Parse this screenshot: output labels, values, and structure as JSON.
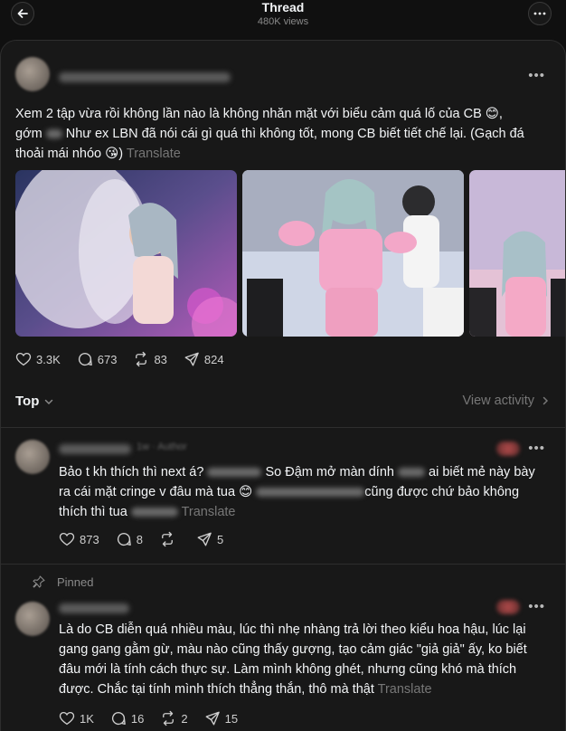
{
  "header": {
    "title": "Thread",
    "views": "480K views"
  },
  "post": {
    "text_line1": "Xem 2 tập vừa rồi không lần nào là không nhăn mặt với biểu cảm quá lố của CB ",
    "emoji1": "😊",
    "text_line1_end": ",",
    "text_line2_a": "gớm",
    "text_line2_b": " Như ex LBN đã nói cái gì quá thì không tốt, mong CB biết tiết chế lại. (Gạch đá",
    "text_line3": "thoải mái nhóo ",
    "emoji2": "😘",
    "text_line3_end": ")",
    "translate": "Translate",
    "likes": "3.3K",
    "replies": "673",
    "reposts": "83",
    "shares": "824"
  },
  "sort": {
    "label": "Top",
    "view_activity": "View activity"
  },
  "comments": [
    {
      "author_tag": "1w · Author",
      "line1_a": "Bảo t kh thích thì next á?",
      "line1_b": "So Đậm mở màn dính",
      "line1_c": "ai biết mẻ này bày",
      "line2_a": "ra cái mặt cringe v đâu mà tua ",
      "emoji": "😊",
      "line2_b": "cũng được chứ bảo không",
      "line3_a": "thích thì tua",
      "translate": "Translate",
      "likes": "873",
      "replies": "8",
      "reposts": "",
      "shares": "5"
    },
    {
      "pinned": "Pinned",
      "line1": "Là do CB diễn quá nhiều màu, lúc thì nhẹ nhàng trả lời theo kiểu hoa hậu, lúc lại",
      "line2": "gang gang gằm gừ, màu nào cũng thấy gượng, tạo cảm giác \"giả giả\" ấy, ko biết",
      "line3": "đâu mới là tính cách thực sự. Làm mình không ghét, nhưng cũng khó mà thích",
      "line4": "được. Chắc tại tính mình thích thẳng thắn, thô mà thật ",
      "translate": "Translate",
      "likes": "1K",
      "replies": "16",
      "reposts": "2",
      "shares": "15"
    }
  ],
  "icons": {
    "back": "arrow-left-icon",
    "more": "more-dots-icon",
    "like": "heart-icon",
    "reply": "comment-icon",
    "repost": "repost-icon",
    "share": "send-icon",
    "pin": "pin-icon"
  },
  "colors": {
    "background": "#101010",
    "card": "#181818",
    "text": "#f3f5f7",
    "muted": "#777777",
    "pink": "#f0a6c8"
  }
}
